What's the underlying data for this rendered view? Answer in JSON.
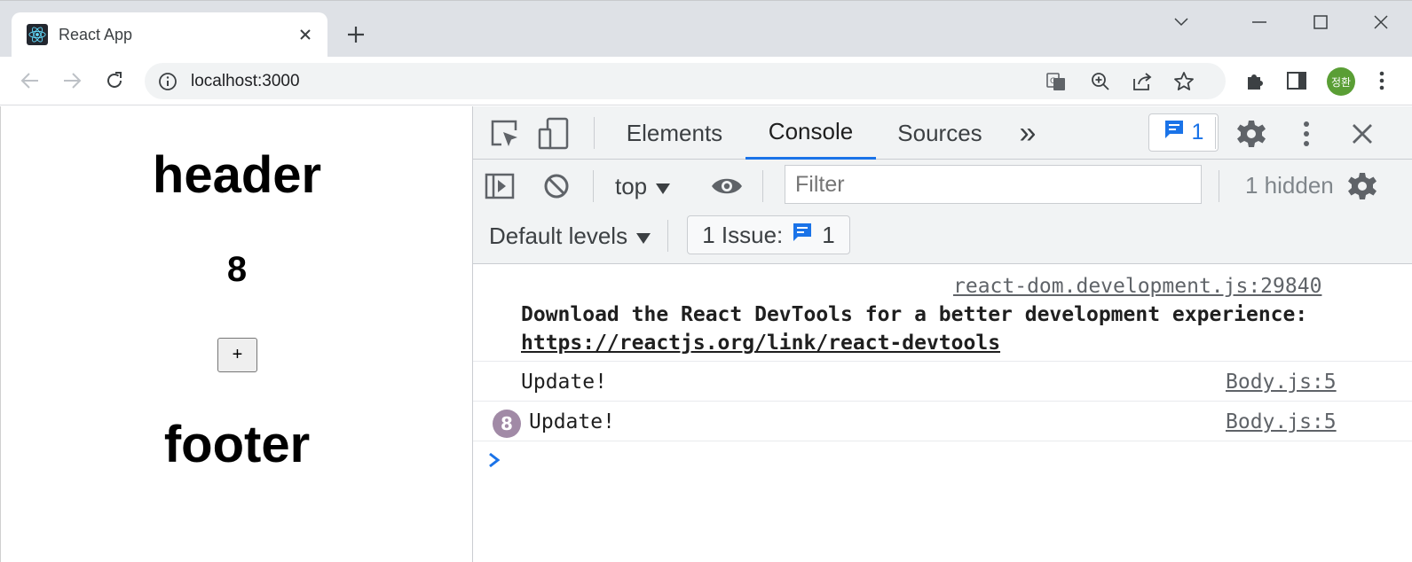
{
  "browser": {
    "tab": {
      "title": "React App",
      "favicon": "react-logo-icon"
    },
    "omnibox": {
      "url": "localhost:3000"
    },
    "profile": {
      "initials": "정환"
    }
  },
  "page": {
    "header": "header",
    "count": "8",
    "increment_label": "+",
    "footer": "footer"
  },
  "devtools": {
    "tabs": [
      {
        "label": "Elements",
        "active": false
      },
      {
        "label": "Console",
        "active": true
      },
      {
        "label": "Sources",
        "active": false
      }
    ],
    "more_tabs_label": "»",
    "issues_count": "1",
    "context": "top",
    "filter_placeholder": "Filter",
    "hidden": "1 hidden",
    "levels": "Default levels",
    "issue_chip": {
      "label": "1 Issue:",
      "count": "1"
    }
  },
  "console": {
    "messages": [
      {
        "source": "react-dom.development.js:29840",
        "text": "Download the React DevTools for a better development experience:",
        "link": "https://reactjs.org/link/react-devtools"
      },
      {
        "text": "Update!",
        "source": "Body.js:5"
      },
      {
        "repeat": "8",
        "text": "Update!",
        "source": "Body.js:5"
      }
    ]
  },
  "colors": {
    "accent": "#1a73e8",
    "repeat_badge": "#a18aa6",
    "avatar": "#5a9e35"
  }
}
